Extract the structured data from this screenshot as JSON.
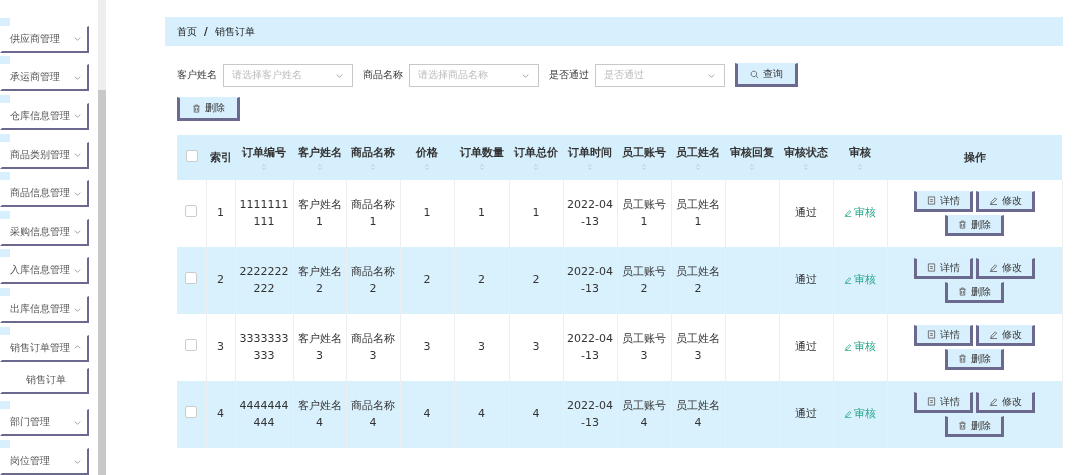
{
  "sidebar": {
    "items": [
      {
        "label": "供应商管理",
        "expanded": false
      },
      {
        "label": "承运商管理",
        "expanded": false
      },
      {
        "label": "仓库信息管理",
        "expanded": false
      },
      {
        "label": "商品类别管理",
        "expanded": false
      },
      {
        "label": "商品信息管理",
        "expanded": false
      },
      {
        "label": "采购信息管理",
        "expanded": false
      },
      {
        "label": "入库信息管理",
        "expanded": false
      },
      {
        "label": "出库信息管理",
        "expanded": false
      },
      {
        "label": "销售订单管理",
        "expanded": true,
        "children": [
          {
            "label": "销售订单"
          }
        ]
      },
      {
        "label": "部门管理",
        "expanded": false
      },
      {
        "label": "岗位管理",
        "expanded": false
      }
    ]
  },
  "breadcrumb": [
    "首页",
    "/",
    "销售订单"
  ],
  "filters": [
    {
      "label": "客户姓名",
      "placeholder": "请选择客户姓名"
    },
    {
      "label": "商品名称",
      "placeholder": "请选择商品名称"
    },
    {
      "label": "是否通过",
      "placeholder": "是否通过"
    }
  ],
  "search_button": "查询",
  "delete_button": "删除",
  "table": {
    "select_all_checked": false,
    "columns": [
      {
        "label": "索引",
        "sortable": false
      },
      {
        "label": "订单编号",
        "sortable": true
      },
      {
        "label": "客户姓名",
        "sortable": true
      },
      {
        "label": "商品名称",
        "sortable": true
      },
      {
        "label": "价格",
        "sortable": true
      },
      {
        "label": "订单数量",
        "sortable": true
      },
      {
        "label": "订单总价",
        "sortable": true
      },
      {
        "label": "订单时间",
        "sortable": true
      },
      {
        "label": "员工账号",
        "sortable": true
      },
      {
        "label": "员工姓名",
        "sortable": true
      },
      {
        "label": "审核回复",
        "sortable": true
      },
      {
        "label": "审核状态",
        "sortable": true
      },
      {
        "label": "审核",
        "sortable": true
      },
      {
        "label": "操作",
        "sortable": false
      }
    ],
    "rows": [
      {
        "checked": false,
        "cells": [
          "1",
          "1111111111",
          "客户姓名1",
          "商品名称1",
          "1",
          "1",
          "1",
          "2022-04-13",
          "员工账号1",
          "员工姓名1",
          "",
          "通过"
        ],
        "review_link": "审核",
        "actions": [
          "详情",
          "修改",
          "删除"
        ]
      },
      {
        "checked": false,
        "cells": [
          "2",
          "2222222222",
          "客户姓名2",
          "商品名称2",
          "2",
          "2",
          "2",
          "2022-04-13",
          "员工账号2",
          "员工姓名2",
          "",
          "通过"
        ],
        "review_link": "审核",
        "actions": [
          "详情",
          "修改",
          "删除"
        ]
      },
      {
        "checked": false,
        "cells": [
          "3",
          "3333333333",
          "客户姓名3",
          "商品名称3",
          "3",
          "3",
          "3",
          "2022-04-13",
          "员工账号3",
          "员工姓名3",
          "",
          "通过"
        ],
        "review_link": "审核",
        "actions": [
          "详情",
          "修改",
          "删除"
        ]
      },
      {
        "checked": false,
        "cells": [
          "4",
          "4444444444",
          "客户姓名4",
          "商品名称4",
          "4",
          "4",
          "4",
          "2022-04-13",
          "员工账号4",
          "员工姓名4",
          "",
          "通过"
        ],
        "review_link": "审核",
        "actions": [
          "详情",
          "修改",
          "删除"
        ]
      }
    ]
  }
}
